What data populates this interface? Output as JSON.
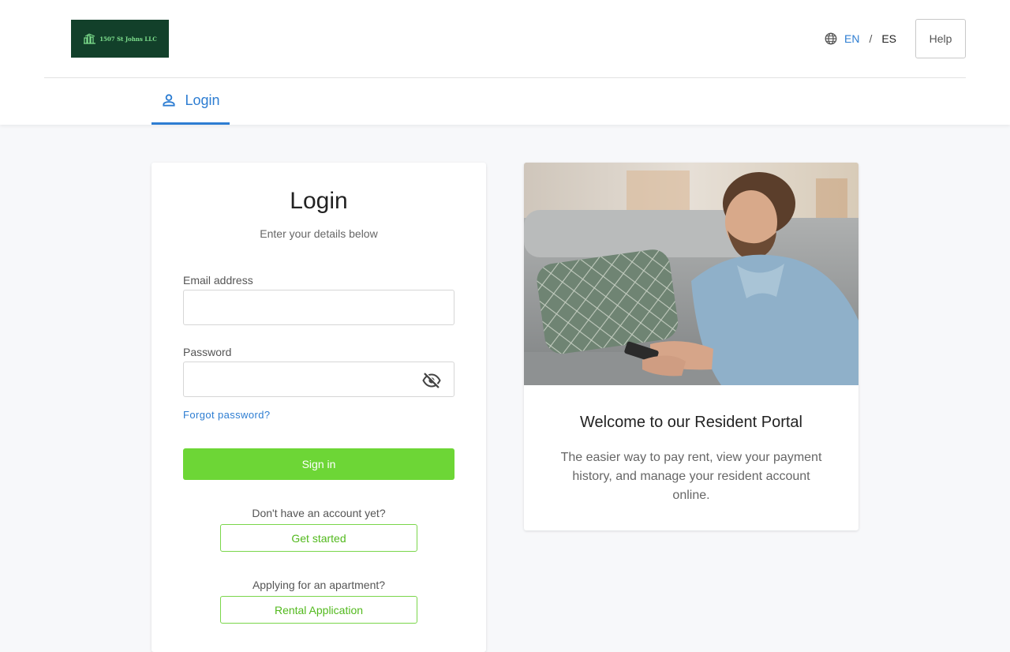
{
  "header": {
    "logo_text": "1507 St Johns LLC",
    "languages": {
      "current": "EN",
      "separator": "/",
      "other": "ES"
    },
    "help_label": "Help",
    "tab_label": "Login"
  },
  "login": {
    "title": "Login",
    "subtitle": "Enter your details below",
    "email_label": "Email address",
    "email_value": "",
    "password_label": "Password",
    "password_value": "",
    "forgot_label": "Forgot password?",
    "signin_label": "Sign in",
    "signup_prompt": "Don't have an account yet?",
    "signup_label": "Get started",
    "apply_prompt": "Applying for an apartment?",
    "apply_label": "Rental Application"
  },
  "welcome": {
    "title": "Welcome to our Resident Portal",
    "text": "The easier way to pay rent, view your payment history, and manage your resident account online."
  },
  "colors": {
    "accent": "#2d7dd2",
    "primary_button": "#6dd636",
    "logo_bg": "#12402a"
  },
  "icons": [
    "globe-icon",
    "user-icon",
    "eye-off-icon",
    "logo-building-icon"
  ]
}
